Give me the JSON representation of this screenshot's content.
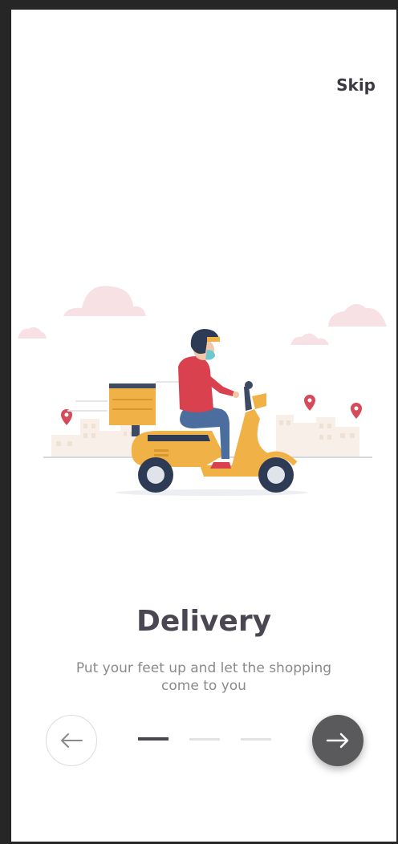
{
  "onboarding": {
    "skip_label": "Skip",
    "title": "Delivery",
    "subtitle": "Put your feet up and let the shopping come to you",
    "current_page": 1,
    "total_pages": 3
  },
  "icons": {
    "prev": "arrow-left-icon",
    "next": "arrow-right-icon"
  },
  "colors": {
    "title": "#4a4753",
    "subtitle": "#8a8a8a",
    "next_button": "#5a5a5c",
    "indicator_active": "#4a4753",
    "indicator_inactive": "#e3e3e3",
    "scooter": "#f0b247",
    "rider_shirt": "#d9414f"
  }
}
